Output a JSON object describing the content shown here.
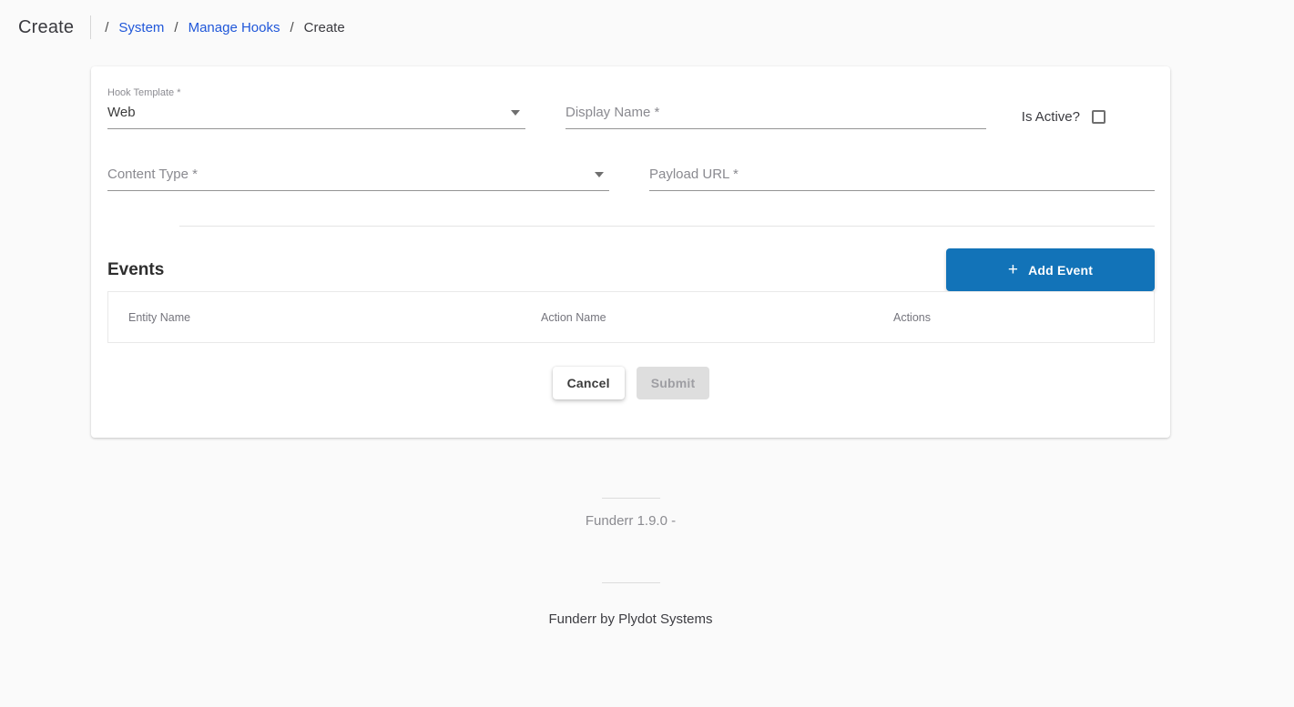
{
  "page": {
    "title": "Create",
    "breadcrumb": {
      "separator": "/",
      "items": [
        {
          "label": "System"
        },
        {
          "label": "Manage Hooks"
        },
        {
          "label": "Create"
        }
      ]
    }
  },
  "form": {
    "hook_template": {
      "label": "Hook Template *",
      "value": "Web"
    },
    "display_name": {
      "placeholder": "Display Name *",
      "value": ""
    },
    "is_active": {
      "label": "Is Active?",
      "checked": false
    },
    "content_type": {
      "placeholder": "Content Type *",
      "value": ""
    },
    "payload_url": {
      "placeholder": "Payload URL *",
      "value": ""
    }
  },
  "events": {
    "title": "Events",
    "add_button": {
      "label": "Add Event",
      "plus_glyph": "+"
    },
    "table": {
      "columns": [
        "Entity Name",
        "Action Name",
        "Actions"
      ],
      "rows": []
    }
  },
  "actions": {
    "cancel_label": "Cancel",
    "submit_label": "Submit",
    "submit_disabled": true
  },
  "footer": {
    "version_text": "Funderr 1.9.0 -",
    "credit_text": "Funderr by Plydot Systems"
  },
  "colors": {
    "accent_blue": "#1273b8",
    "link_blue": "#2057d9",
    "page_bg": "#fafafa",
    "card_bg": "#ffffff"
  }
}
